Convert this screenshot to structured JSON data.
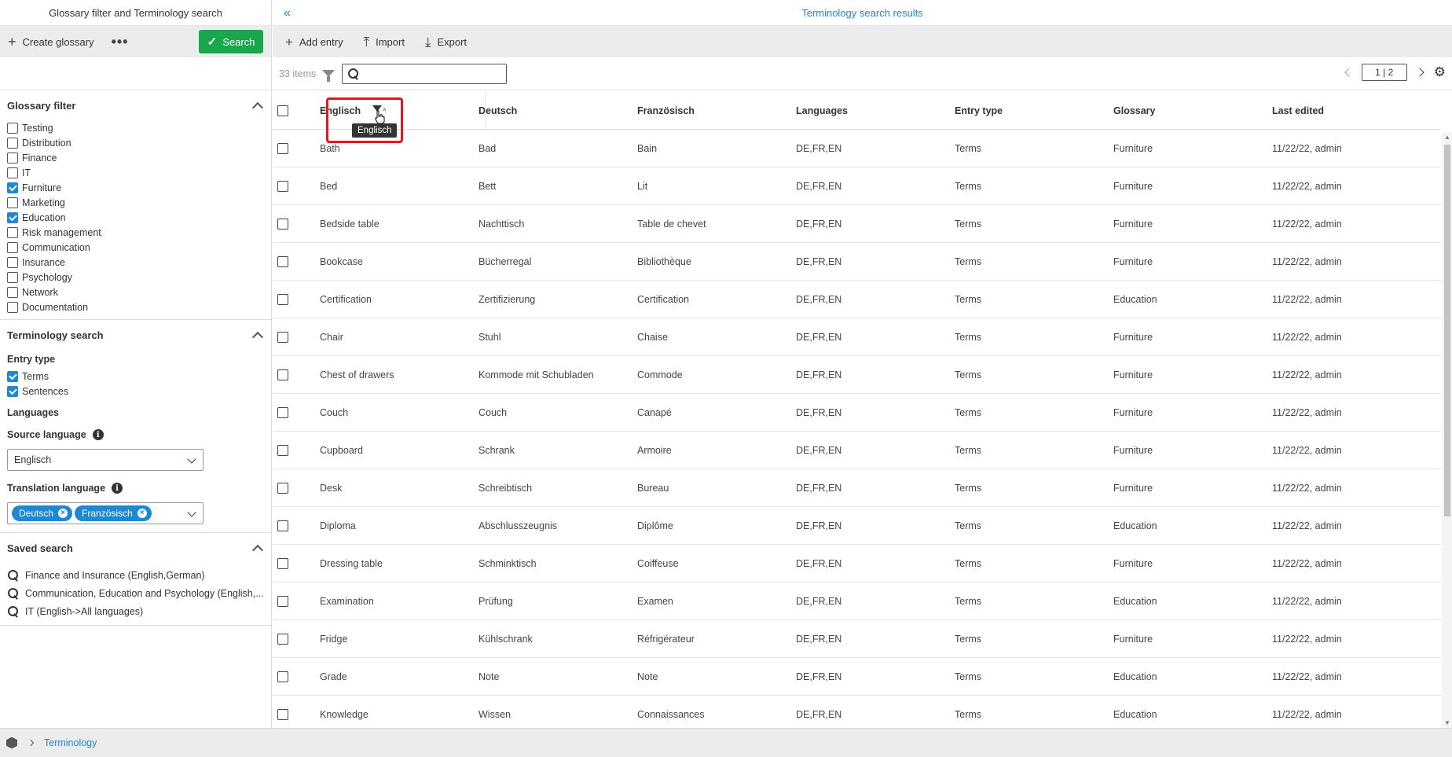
{
  "left": {
    "title": "Glossary filter and Terminology search",
    "toolbar": {
      "create_label": "Create glossary",
      "more_label": "•••",
      "search_label": "Search"
    },
    "glossary_filter": {
      "title": "Glossary filter",
      "items": [
        {
          "label": "Testing",
          "checked": false
        },
        {
          "label": "Distribution",
          "checked": false
        },
        {
          "label": "Finance",
          "checked": false
        },
        {
          "label": "IT",
          "checked": false
        },
        {
          "label": "Furniture",
          "checked": true
        },
        {
          "label": "Marketing",
          "checked": false
        },
        {
          "label": "Education",
          "checked": true
        },
        {
          "label": "Risk management",
          "checked": false
        },
        {
          "label": "Communication",
          "checked": false
        },
        {
          "label": "Insurance",
          "checked": false
        },
        {
          "label": "Psychology",
          "checked": false
        },
        {
          "label": "Network",
          "checked": false
        },
        {
          "label": "Documentation",
          "checked": false
        }
      ]
    },
    "terminology_search": {
      "title": "Terminology search",
      "entry_type_label": "Entry type",
      "entry_types": [
        {
          "label": "Terms",
          "checked": true
        },
        {
          "label": "Sentences",
          "checked": true
        }
      ],
      "languages_label": "Languages",
      "source_language_label": "Source language",
      "source_language_value": "Englisch",
      "translation_language_label": "Translation language",
      "translation_languages": [
        "Deutsch",
        "Französisch"
      ]
    },
    "saved_search": {
      "title": "Saved search",
      "items": [
        "Finance and Insurance (English,German)",
        "Communication, Education and Psychology (English,...",
        "IT (English->All languages)"
      ]
    }
  },
  "right": {
    "title": "Terminology search results",
    "toolbar": {
      "add_label": "Add entry",
      "import_label": "Import",
      "export_label": "Export"
    },
    "items_count": "33 items",
    "search_placeholder": "",
    "page": "1 | 2",
    "tooltip": "Englisch",
    "columns": [
      "Englisch",
      "Deutsch",
      "Französisch",
      "Languages",
      "Entry type",
      "Glossary",
      "Last edited"
    ],
    "rows": [
      [
        "Bath",
        "Bad",
        "Bain",
        "DE,FR,EN",
        "Terms",
        "Furniture",
        "11/22/22, admin"
      ],
      [
        "Bed",
        "Bett",
        "Lit",
        "DE,FR,EN",
        "Terms",
        "Furniture",
        "11/22/22, admin"
      ],
      [
        "Bedside table",
        "Nachttisch",
        "Table de chevet",
        "DE,FR,EN",
        "Terms",
        "Furniture",
        "11/22/22, admin"
      ],
      [
        "Bookcase",
        "Bücherregal",
        "Bibliothèque",
        "DE,FR,EN",
        "Terms",
        "Furniture",
        "11/22/22, admin"
      ],
      [
        "Certification",
        "Zertifizierung",
        "Certification",
        "DE,FR,EN",
        "Terms",
        "Education",
        "11/22/22, admin"
      ],
      [
        "Chair",
        "Stuhl",
        "Chaise",
        "DE,FR,EN",
        "Terms",
        "Furniture",
        "11/22/22, admin"
      ],
      [
        "Chest of drawers",
        "Kommode mit Schubladen",
        "Commode",
        "DE,FR,EN",
        "Terms",
        "Furniture",
        "11/22/22, admin"
      ],
      [
        "Couch",
        "Couch",
        "Canapé",
        "DE,FR,EN",
        "Terms",
        "Furniture",
        "11/22/22, admin"
      ],
      [
        "Cupboard",
        "Schrank",
        "Armoire",
        "DE,FR,EN",
        "Terms",
        "Furniture",
        "11/22/22, admin"
      ],
      [
        "Desk",
        "Schreibtisch",
        "Bureau",
        "DE,FR,EN",
        "Terms",
        "Furniture",
        "11/22/22, admin"
      ],
      [
        "Diploma",
        "Abschlusszeugnis",
        "Diplôme",
        "DE,FR,EN",
        "Terms",
        "Education",
        "11/22/22, admin"
      ],
      [
        "Dressing table",
        "Schminktisch",
        "Coiffeuse",
        "DE,FR,EN",
        "Terms",
        "Furniture",
        "11/22/22, admin"
      ],
      [
        "Examination",
        "Prüfung",
        "Examen",
        "DE,FR,EN",
        "Terms",
        "Education",
        "11/22/22, admin"
      ],
      [
        "Fridge",
        "Kühlschrank",
        "Réfrigérateur",
        "DE,FR,EN",
        "Terms",
        "Furniture",
        "11/22/22, admin"
      ],
      [
        "Grade",
        "Note",
        "Note",
        "DE,FR,EN",
        "Terms",
        "Education",
        "11/22/22, admin"
      ],
      [
        "Knowledge",
        "Wissen",
        "Connaissances",
        "DE,FR,EN",
        "Terms",
        "Education",
        "11/22/22, admin"
      ]
    ]
  },
  "footer": {
    "breadcrumb": "Terminology"
  },
  "colors": {
    "accent": "#1e88d2",
    "search_button": "#1aa64a",
    "highlight": "#e8151f"
  }
}
